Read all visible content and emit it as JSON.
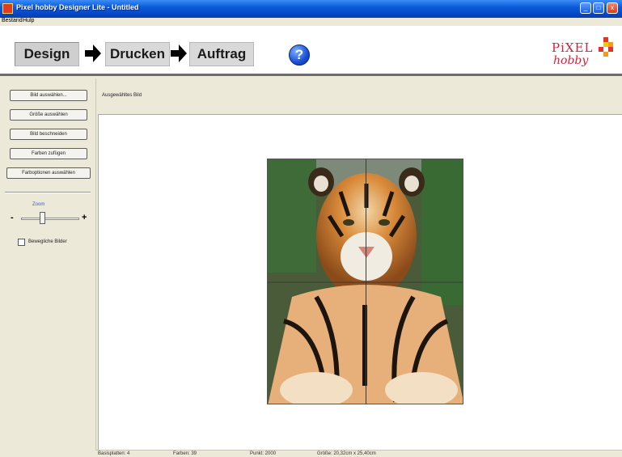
{
  "window": {
    "title": "Pixel hobby Designer Lite - Untitled",
    "controls": [
      "_",
      "□",
      "x"
    ]
  },
  "menu": [
    "Bestand",
    "Hulp"
  ],
  "toolbar": {
    "steps": [
      {
        "label": "Design",
        "active": true
      },
      {
        "label": "Drucken",
        "active": false
      },
      {
        "label": "Auftrag",
        "active": false
      }
    ],
    "help_label": "?",
    "logo_line1": "PiXEL",
    "logo_line2": "hobby"
  },
  "sidebar": {
    "buttons": [
      "Bild auswählen...",
      "Größe auswählen",
      "Bild beschneiden",
      "Farben zufügen",
      "Farboptionen auswählen"
    ],
    "zoom_label": "Zoom",
    "zoom_minus": "-",
    "zoom_plus": "+",
    "zoom_level": 0.35,
    "checkbox_label": "Bewegliche Bilder",
    "checkbox_checked": false
  },
  "main": {
    "image_label": "Ausgewähltes Bild"
  },
  "statusbar": {
    "items": [
      "Basisplatten: 4",
      "Farben: 39",
      "Punkt: 2000",
      "Größe: 20,32cm x 25,40cm"
    ]
  },
  "colors": {
    "titlebar": "#0a5bd8",
    "accent_red": "#d81e3a",
    "background": "#ece9d8"
  }
}
